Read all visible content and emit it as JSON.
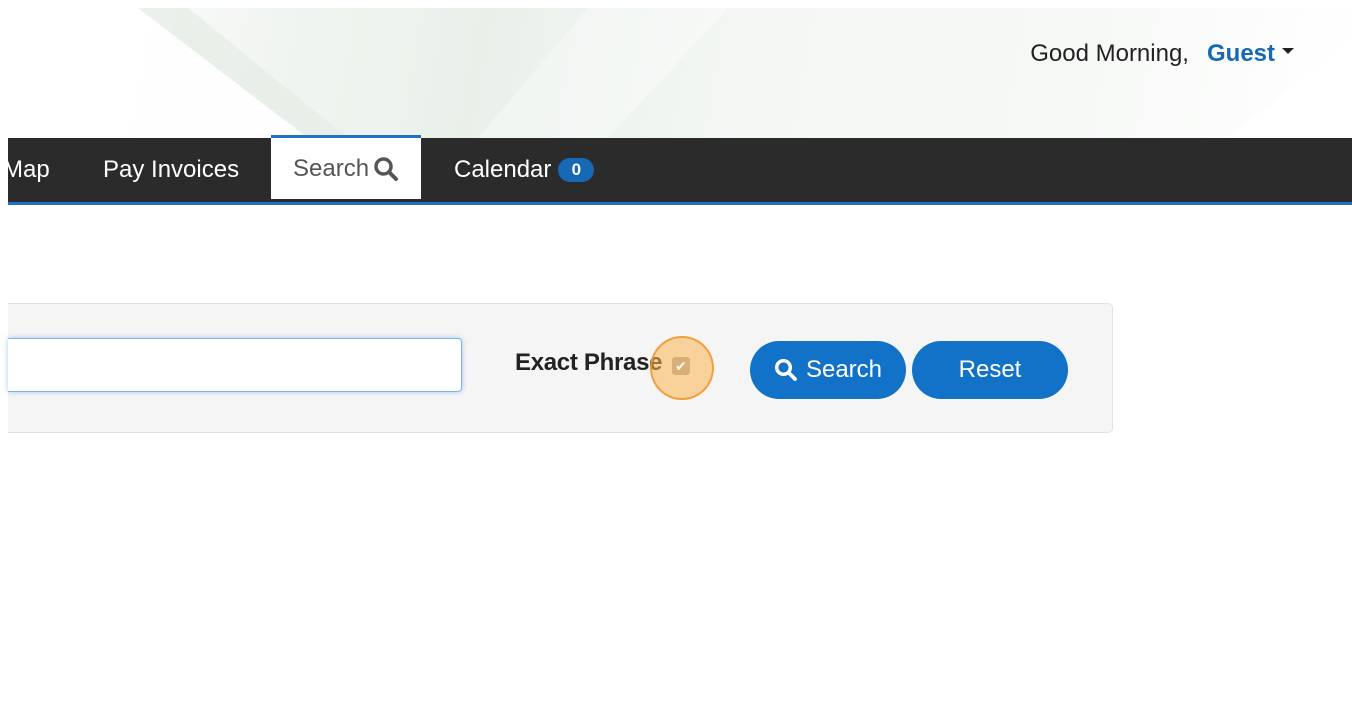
{
  "header": {
    "greeting": "Good Morning,",
    "user_name": "Guest"
  },
  "nav": {
    "items": [
      {
        "label": "Map"
      },
      {
        "label": "Pay Invoices"
      },
      {
        "label": "Search",
        "active": true,
        "icon": "search-icon"
      },
      {
        "label": "Calendar",
        "badge": "0"
      }
    ]
  },
  "search_panel": {
    "input_value": "",
    "exact_phrase_label": "Exact Phrase",
    "exact_phrase_checked": true,
    "search_button_label": "Search",
    "reset_button_label": "Reset"
  },
  "colors": {
    "nav_background": "#2b2b2b",
    "accent_blue": "#1272c8",
    "user_link": "#1769b5",
    "click_highlight": "#fcb250"
  }
}
